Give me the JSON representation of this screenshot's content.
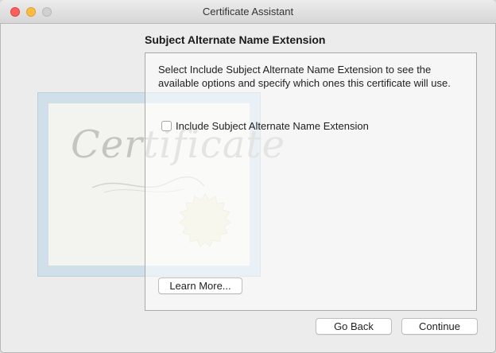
{
  "window": {
    "title": "Certificate Assistant",
    "traffic_lights": {
      "close_color": "#fc605c",
      "minimize_color": "#fdbc40",
      "zoom_color": "#d0d0d0"
    }
  },
  "page": {
    "heading": "Subject Alternate Name Extension",
    "description": "Select Include Subject Alternate Name Extension to see the available options and specify which ones this certificate will use.",
    "checkbox": {
      "label": "Include Subject Alternate Name Extension",
      "checked": false
    },
    "learn_more_label": "Learn More..."
  },
  "illustration": {
    "script_text": "Certificate",
    "icon": "certificate-illustration"
  },
  "footer": {
    "go_back_label": "Go Back",
    "continue_label": "Continue"
  }
}
